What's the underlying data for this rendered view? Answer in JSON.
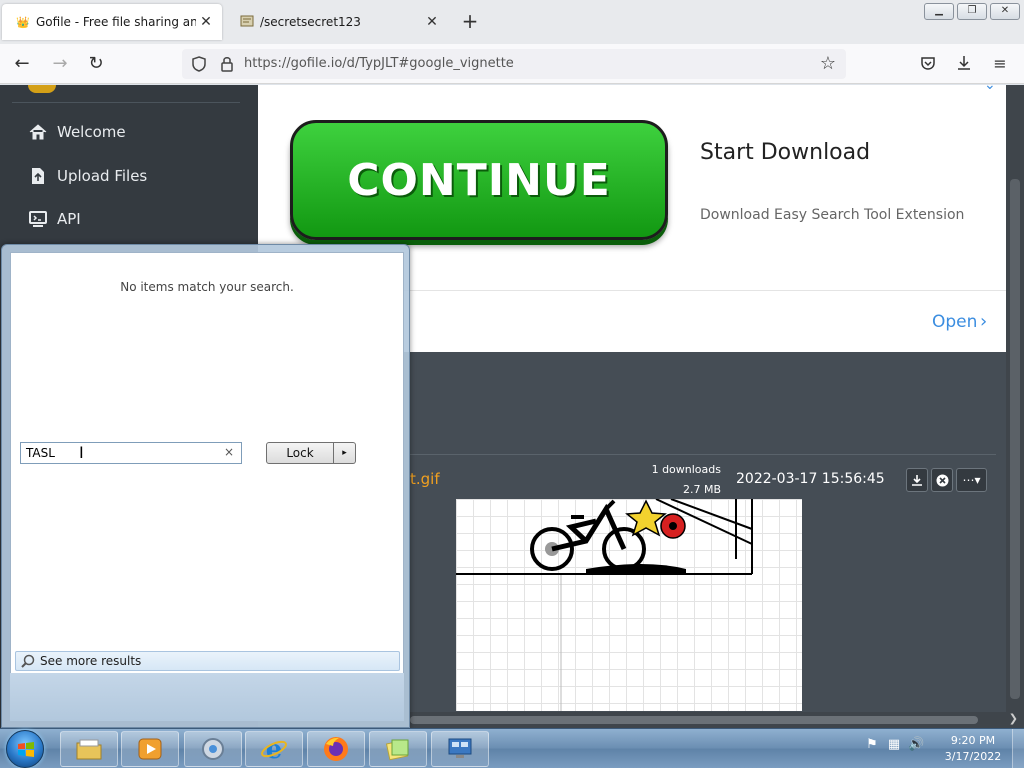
{
  "browser": {
    "tabs": [
      {
        "title": "Gofile - Free file sharing and sto",
        "active": true
      },
      {
        "title": "/secretsecret123",
        "active": false
      }
    ],
    "url": "https://gofile.io/d/TypJLT#google_vignette",
    "new_tab_glyph": "+",
    "close_glyph": "✕"
  },
  "sidebar": {
    "items": [
      {
        "label": "Welcome",
        "icon": "home-icon"
      },
      {
        "label": "Upload Files",
        "icon": "file-upload-icon"
      },
      {
        "label": "API",
        "icon": "api-icon"
      }
    ]
  },
  "ad": {
    "button_label": "CONTINUE",
    "title": "Start Download",
    "description": "Download Easy Search Tool Extension",
    "open_label": "Open",
    "open_chevron": "›",
    "button_color": "#22b522",
    "link_color": "#3b8de0"
  },
  "file": {
    "name_fragment": "t.gif",
    "downloads": "1 downloads",
    "size": "2.7 MB",
    "date": "2022-03-17 15:56:45",
    "name_color": "#f0a020"
  },
  "start_menu": {
    "no_items": "No items match your search.",
    "see_more": "See more results",
    "search_value": "TASL",
    "clear_glyph": "×",
    "lock_label": "Lock",
    "lock_arrow": "▸"
  },
  "taskbar": {
    "apps": [
      "explorer-icon",
      "media-player-icon",
      "control-panel-icon",
      "internet-explorer-icon",
      "firefox-icon",
      "sticky-notes-icon",
      "remote-desktop-icon"
    ],
    "time": "9:20 PM",
    "date": "3/17/2022"
  }
}
